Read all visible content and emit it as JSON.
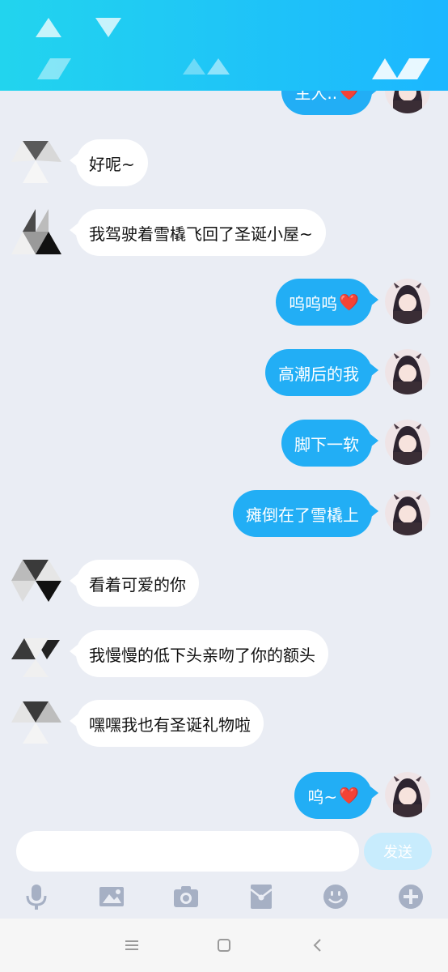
{
  "messages": [
    {
      "side": "right",
      "text": "主人..",
      "heart": true
    },
    {
      "side": "left",
      "text": "好呢~"
    },
    {
      "side": "left",
      "text": "我驾驶着雪橇飞回了圣诞小屋~"
    },
    {
      "side": "right",
      "text": "呜呜呜",
      "heart": true
    },
    {
      "side": "right",
      "text": "高潮后的我"
    },
    {
      "side": "right",
      "text": "脚下一软"
    },
    {
      "side": "right",
      "text": "瘫倒在了雪橇上"
    },
    {
      "side": "left",
      "text": "看着可爱的你"
    },
    {
      "side": "left",
      "text": "我慢慢的低下头亲吻了你的额头"
    },
    {
      "side": "left",
      "text": "嘿嘿我也有圣诞礼物啦"
    },
    {
      "side": "right",
      "text": "呜~",
      "heart": true
    }
  ],
  "heart_glyph": "❤️",
  "composer": {
    "placeholder": "",
    "send_label": "发送"
  },
  "toolbar": [
    "microphone-icon",
    "image-icon",
    "camera-icon",
    "red-packet-icon",
    "emoji-icon",
    "plus-icon"
  ],
  "colors": {
    "accent": "#22aef5",
    "header": "#1cb7ff",
    "background": "#eaedf4"
  }
}
